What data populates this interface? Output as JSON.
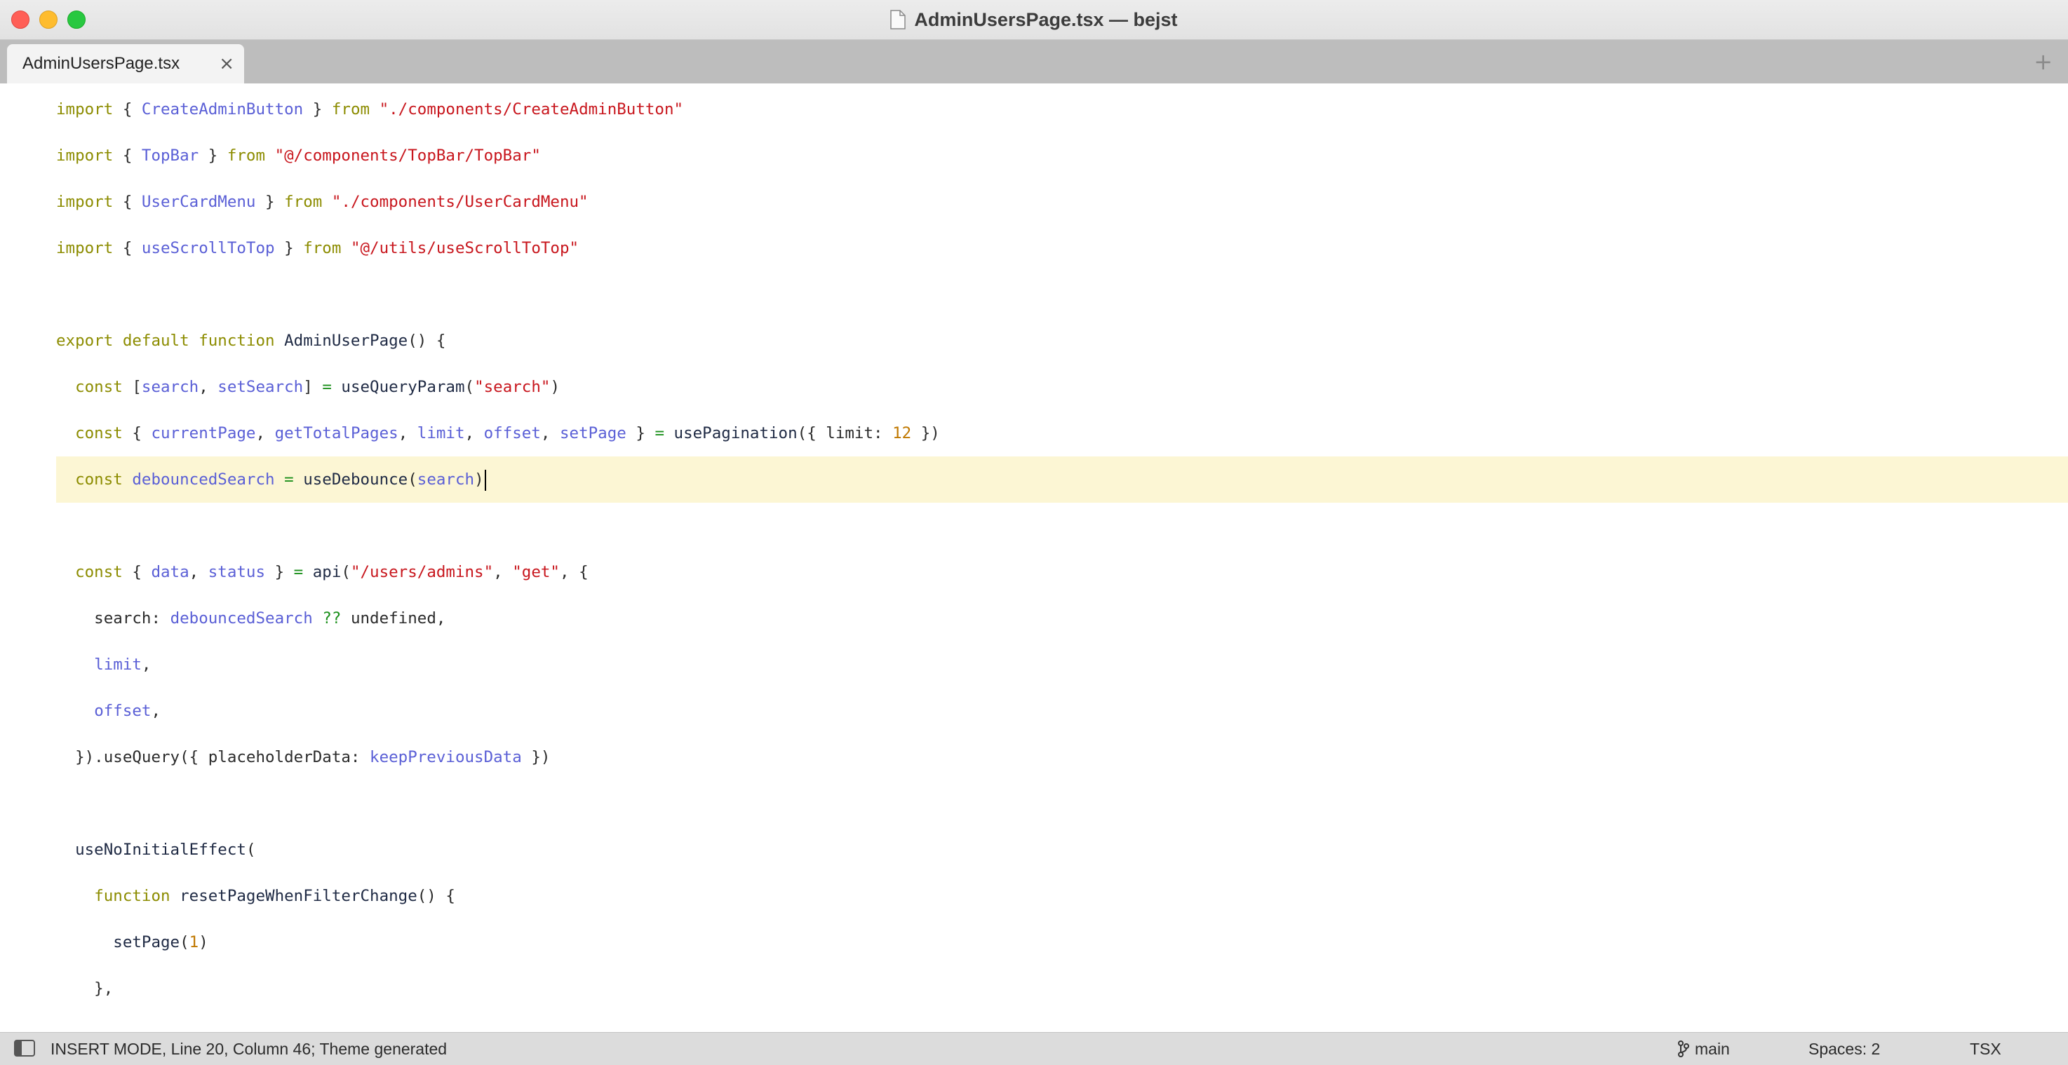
{
  "window": {
    "title": "AdminUsersPage.tsx — bejst"
  },
  "tabs": [
    {
      "label": "AdminUsersPage.tsx",
      "close_glyph": "×"
    }
  ],
  "tabbar": {
    "add_glyph": "+"
  },
  "code_lines": [
    [
      [
        "kw",
        "import"
      ],
      [
        "pn",
        " { "
      ],
      [
        "id",
        "CreateAdminButton"
      ],
      [
        "pn",
        " } "
      ],
      [
        "kw",
        "from"
      ],
      [
        "pn",
        " "
      ],
      [
        "str",
        "\"./components/CreateAdminButton\""
      ]
    ],
    [
      [
        "kw",
        "import"
      ],
      [
        "pn",
        " { "
      ],
      [
        "id",
        "TopBar"
      ],
      [
        "pn",
        " } "
      ],
      [
        "kw",
        "from"
      ],
      [
        "pn",
        " "
      ],
      [
        "str",
        "\"@/components/TopBar/TopBar\""
      ]
    ],
    [
      [
        "kw",
        "import"
      ],
      [
        "pn",
        " { "
      ],
      [
        "id",
        "UserCardMenu"
      ],
      [
        "pn",
        " } "
      ],
      [
        "kw",
        "from"
      ],
      [
        "pn",
        " "
      ],
      [
        "str",
        "\"./components/UserCardMenu\""
      ]
    ],
    [
      [
        "kw",
        "import"
      ],
      [
        "pn",
        " { "
      ],
      [
        "id",
        "useScrollToTop"
      ],
      [
        "pn",
        " } "
      ],
      [
        "kw",
        "from"
      ],
      [
        "pn",
        " "
      ],
      [
        "str",
        "\"@/utils/useScrollToTop\""
      ]
    ],
    [],
    [
      [
        "kw",
        "export default function"
      ],
      [
        "pn",
        " "
      ],
      [
        "fn",
        "AdminUserPage"
      ],
      [
        "pn",
        "() {"
      ]
    ],
    [
      [
        "pn",
        "  "
      ],
      [
        "kw",
        "const"
      ],
      [
        "pn",
        " ["
      ],
      [
        "id",
        "search"
      ],
      [
        "pn",
        ", "
      ],
      [
        "id",
        "setSearch"
      ],
      [
        "pn",
        "] "
      ],
      [
        "op",
        "="
      ],
      [
        "pn",
        " "
      ],
      [
        "fn",
        "useQueryParam"
      ],
      [
        "pn",
        "("
      ],
      [
        "str",
        "\"search\""
      ],
      [
        "pn",
        ")"
      ]
    ],
    [
      [
        "pn",
        "  "
      ],
      [
        "kw",
        "const"
      ],
      [
        "pn",
        " { "
      ],
      [
        "id",
        "currentPage"
      ],
      [
        "pn",
        ", "
      ],
      [
        "id",
        "getTotalPages"
      ],
      [
        "pn",
        ", "
      ],
      [
        "id",
        "limit"
      ],
      [
        "pn",
        ", "
      ],
      [
        "id",
        "offset"
      ],
      [
        "pn",
        ", "
      ],
      [
        "id",
        "setPage"
      ],
      [
        "pn",
        " } "
      ],
      [
        "op",
        "="
      ],
      [
        "pn",
        " "
      ],
      [
        "fn",
        "usePagination"
      ],
      [
        "pn",
        "({ limit: "
      ],
      [
        "num",
        "12"
      ],
      [
        "pn",
        " })"
      ]
    ],
    [
      [
        "pn",
        "  "
      ],
      [
        "kw",
        "const"
      ],
      [
        "pn",
        " "
      ],
      [
        "id",
        "debouncedSearch"
      ],
      [
        "pn",
        " "
      ],
      [
        "op",
        "="
      ],
      [
        "pn",
        " "
      ],
      [
        "fn",
        "useDebounce"
      ],
      [
        "pn",
        "("
      ],
      [
        "id",
        "search"
      ],
      [
        "pn",
        ")"
      ]
    ],
    [],
    [
      [
        "pn",
        "  "
      ],
      [
        "kw",
        "const"
      ],
      [
        "pn",
        " { "
      ],
      [
        "id",
        "data"
      ],
      [
        "pn",
        ", "
      ],
      [
        "id",
        "status"
      ],
      [
        "pn",
        " } "
      ],
      [
        "op",
        "="
      ],
      [
        "pn",
        " "
      ],
      [
        "fn",
        "api"
      ],
      [
        "pn",
        "("
      ],
      [
        "str",
        "\"/users/admins\""
      ],
      [
        "pn",
        ", "
      ],
      [
        "str",
        "\"get\""
      ],
      [
        "pn",
        ", {"
      ]
    ],
    [
      [
        "pn",
        "    search: "
      ],
      [
        "id",
        "debouncedSearch"
      ],
      [
        "pn",
        " "
      ],
      [
        "op",
        "??"
      ],
      [
        "pn",
        " undefined,"
      ]
    ],
    [
      [
        "pn",
        "    "
      ],
      [
        "id",
        "limit"
      ],
      [
        "pn",
        ","
      ]
    ],
    [
      [
        "pn",
        "    "
      ],
      [
        "id",
        "offset"
      ],
      [
        "pn",
        ","
      ]
    ],
    [
      [
        "pn",
        "  }).useQuery({ placeholderData: "
      ],
      [
        "id",
        "keepPreviousData"
      ],
      [
        "pn",
        " })"
      ]
    ],
    [],
    [
      [
        "pn",
        "  "
      ],
      [
        "fn",
        "useNoInitialEffect"
      ],
      [
        "pn",
        "("
      ]
    ],
    [
      [
        "pn",
        "    "
      ],
      [
        "kw",
        "function"
      ],
      [
        "pn",
        " "
      ],
      [
        "fn",
        "resetPageWhenFilterChange"
      ],
      [
        "pn",
        "() {"
      ]
    ],
    [
      [
        "pn",
        "      "
      ],
      [
        "fn",
        "setPage"
      ],
      [
        "pn",
        "("
      ],
      [
        "num",
        "1"
      ],
      [
        "pn",
        ")"
      ]
    ],
    [
      [
        "pn",
        "    },"
      ]
    ]
  ],
  "editor": {
    "active_line_index": 8
  },
  "statusbar": {
    "mode_text": "INSERT MODE, Line 20, Column 46; Theme generated",
    "branch": "main",
    "spaces": "Spaces: 2",
    "syntax": "TSX"
  },
  "icons": {
    "sidebar_toggle": "sidebar-toggle-icon",
    "document": "document-icon",
    "branch": "git-branch-icon"
  },
  "colors": {
    "keyword": "#8c8c00",
    "identifier": "#5a5fd6",
    "string": "#c8161d",
    "number": "#c07800",
    "operator": "#1a8f1a",
    "active_line": "#fcf6d4"
  }
}
